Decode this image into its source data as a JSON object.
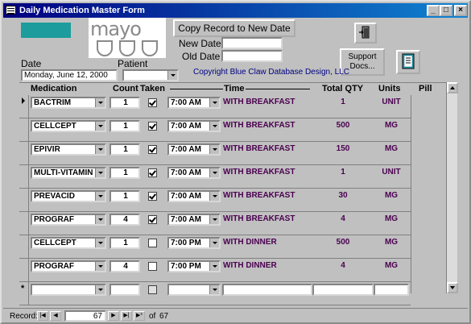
{
  "window": {
    "title": "Daily Medication Master Form",
    "controls": {
      "minimize": "_",
      "maximize": "□",
      "close": "×"
    }
  },
  "header": {
    "logo_text": "mayo",
    "copy_button": "Copy Record to New Date",
    "new_date_label": "New Date",
    "old_date_label": "Old Date",
    "new_date_value": "",
    "old_date_value": "",
    "date_label": "Date",
    "date_value": "Monday, June 12, 2000",
    "patient_label": "Patient",
    "patient_value": "",
    "copyright": "Copyright Blue Claw Database Design, LLC",
    "support_button_line1": "Support",
    "support_button_line2": "Docs..."
  },
  "columns": {
    "medication": "Medication",
    "count": "Count",
    "taken": "Taken",
    "time": "Time",
    "total_qty": "Total QTY",
    "units": "Units",
    "pill": "Pill"
  },
  "rows": [
    {
      "medication": "BACTRIM",
      "count": "1",
      "taken": true,
      "time": "7:00 AM",
      "instruction": "WITH BREAKFAST",
      "total": "1",
      "units": "UNIT",
      "pill_color": "#e8e4dc"
    },
    {
      "medication": "CELLCEPT",
      "count": "1",
      "taken": true,
      "time": "7:00 AM",
      "instruction": "WITH BREAKFAST",
      "total": "500",
      "units": "MG",
      "pill_color": "#d8a8a8"
    },
    {
      "medication": "EPIVIR",
      "count": "1",
      "taken": true,
      "time": "7:00 AM",
      "instruction": "WITH BREAKFAST",
      "total": "150",
      "units": "MG",
      "pill_color": "#ecebe4"
    },
    {
      "medication": "MULTI-VITAMIN",
      "count": "1",
      "taken": true,
      "time": "7:00 AM",
      "instruction": "WITH BREAKFAST",
      "total": "1",
      "units": "UNIT",
      "pill_color": ""
    },
    {
      "medication": "PREVACID",
      "count": "1",
      "taken": true,
      "time": "7:00 AM",
      "instruction": "WITH BREAKFAST",
      "total": "30",
      "units": "MG",
      "pill_color": "#c06080"
    },
    {
      "medication": "PROGRAF",
      "count": "4",
      "taken": true,
      "time": "7:00 AM",
      "instruction": "WITH BREAKFAST",
      "total": "4",
      "units": "MG",
      "pill_color": "#e6d6b8"
    },
    {
      "medication": "CELLCEPT",
      "count": "1",
      "taken": false,
      "time": "7:00 PM",
      "instruction": "WITH DINNER",
      "total": "500",
      "units": "MG",
      "pill_color": "#d8a8a8"
    },
    {
      "medication": "PROGRAF",
      "count": "4",
      "taken": false,
      "time": "7:00 PM",
      "instruction": "WITH DINNER",
      "total": "4",
      "units": "MG",
      "pill_color": "#e6d6b8"
    }
  ],
  "nav": {
    "record_label": "Record:",
    "current": "67",
    "of_label": "of",
    "total": "67"
  }
}
